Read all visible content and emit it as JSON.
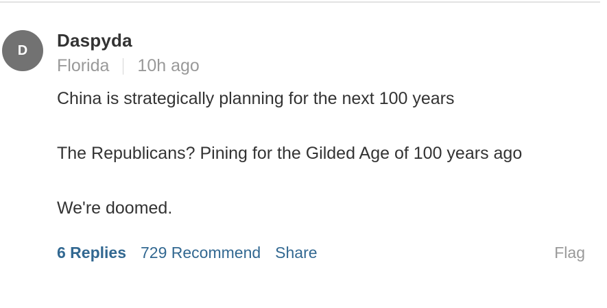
{
  "comment": {
    "avatar_initial": "D",
    "author": "Daspyda",
    "location": "Florida",
    "time": "10h ago",
    "paragraphs": [
      "China is strategically planning for the next 100 years",
      "The Republicans? Pining for the Gilded Age of 100 years ago",
      "We're doomed."
    ],
    "actions": {
      "replies": "6 Replies",
      "recommend": "729 Recommend",
      "share": "Share",
      "flag": "Flag"
    }
  },
  "colors": {
    "link": "#326891",
    "avatar_bg": "#727272",
    "muted": "#999999",
    "text": "#333333"
  }
}
